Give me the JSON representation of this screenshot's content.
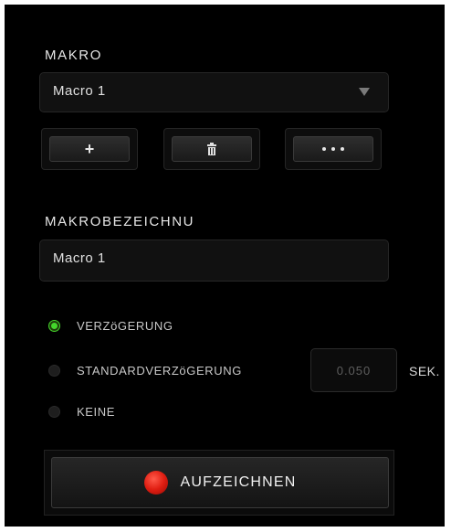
{
  "macro_section": {
    "title": "MAKRO",
    "selected_macro": "Macro 1",
    "buttons": {
      "add": "+",
      "delete_icon": "trash-icon",
      "more_icon": "more-dots-icon"
    }
  },
  "name_section": {
    "title": "MAKROBEZEICHNU",
    "value": "Macro 1"
  },
  "delay_options": [
    {
      "label": "VERZöGERUNG",
      "selected": true
    },
    {
      "label": "STANDARDVERZöGERUNG",
      "selected": false
    },
    {
      "label": "KEINE",
      "selected": false
    }
  ],
  "default_delay": {
    "value": "0.050",
    "unit": "SEK."
  },
  "record": {
    "label": "AUFZEICHNEN"
  },
  "colors": {
    "accent_green": "#44d62c",
    "record_red": "#e01e12",
    "background": "#000000"
  }
}
